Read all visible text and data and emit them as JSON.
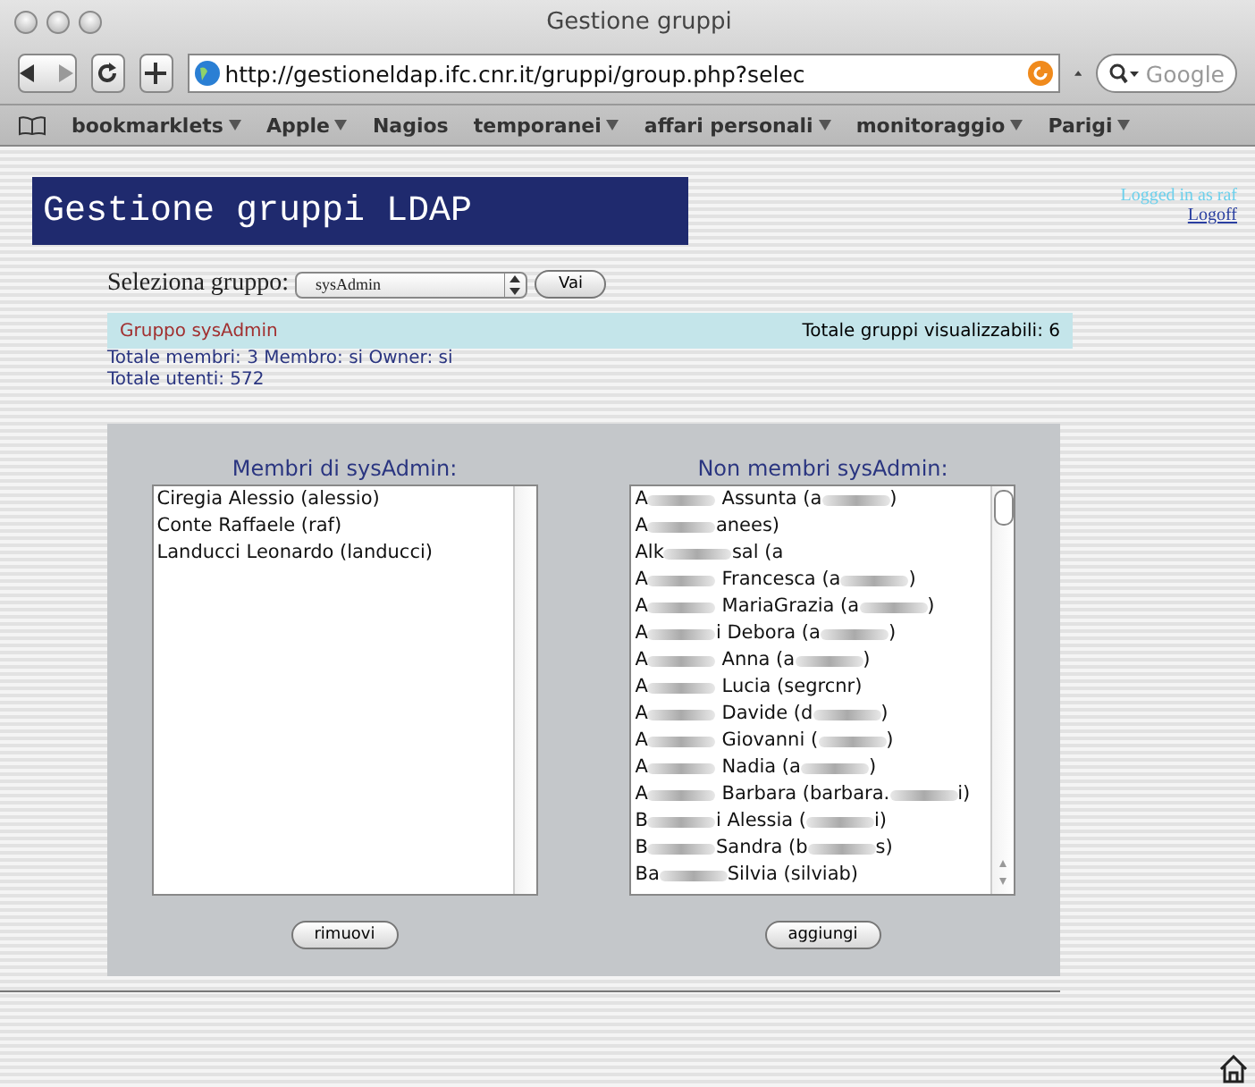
{
  "window": {
    "title": "Gestione gruppi"
  },
  "toolbar": {
    "url": "http://gestioneldap.ifc.cnr.it/gruppi/group.php?selec",
    "search_placeholder": "Google"
  },
  "bookmarks": [
    {
      "label": "bookmarklets",
      "menu": true
    },
    {
      "label": "Apple",
      "menu": true
    },
    {
      "label": "Nagios",
      "menu": false
    },
    {
      "label": "temporanei",
      "menu": true
    },
    {
      "label": "affari personali",
      "menu": true
    },
    {
      "label": "monitoraggio",
      "menu": true
    },
    {
      "label": "Parigi",
      "menu": true
    }
  ],
  "page": {
    "banner": "Gestione gruppi LDAP",
    "logged_in": "Logged in as raf",
    "logoff": "Logoff",
    "select_label": "Seleziona gruppo:",
    "select_value": "sysAdmin",
    "go_button": "Vai",
    "group_title": "Gruppo sysAdmin",
    "total_groups": "Totale gruppi visualizzabili: 6",
    "members_info": "Totale membri: 3 Membro: si Owner: si",
    "users_info": "Totale utenti: 572"
  },
  "members": {
    "title": "Membri di sysAdmin:",
    "button": "rimuovi",
    "items": [
      [
        {
          "kind": "text",
          "text": "Ciregia Alessio (alessio)"
        }
      ],
      [
        {
          "kind": "text",
          "text": "Conte Raffaele (raf)"
        }
      ],
      [
        {
          "kind": "text",
          "text": "Landucci Leonardo (landucci)"
        }
      ]
    ]
  },
  "non_members": {
    "title": "Non membri sysAdmin:",
    "button": "aggiungi",
    "items": [
      [
        {
          "kind": "text",
          "text": "A"
        },
        {
          "kind": "blur"
        },
        {
          "kind": "text",
          "text": " Assunta (a"
        },
        {
          "kind": "blur"
        },
        {
          "kind": "text",
          "text": ")"
        }
      ],
      [
        {
          "kind": "text",
          "text": "A"
        },
        {
          "kind": "blur"
        },
        {
          "kind": "text",
          "text": "anees)"
        }
      ],
      [
        {
          "kind": "text",
          "text": "Alk"
        },
        {
          "kind": "blur"
        },
        {
          "kind": "text",
          "text": "sal (a"
        }
      ],
      [
        {
          "kind": "text",
          "text": "A"
        },
        {
          "kind": "blur"
        },
        {
          "kind": "text",
          "text": " Francesca (a"
        },
        {
          "kind": "blur"
        },
        {
          "kind": "text",
          "text": ")"
        }
      ],
      [
        {
          "kind": "text",
          "text": "A"
        },
        {
          "kind": "blur"
        },
        {
          "kind": "text",
          "text": " MariaGrazia (a"
        },
        {
          "kind": "blur"
        },
        {
          "kind": "text",
          "text": ")"
        }
      ],
      [
        {
          "kind": "text",
          "text": "A"
        },
        {
          "kind": "blur"
        },
        {
          "kind": "text",
          "text": "i Debora (a"
        },
        {
          "kind": "blur"
        },
        {
          "kind": "text",
          "text": ")"
        }
      ],
      [
        {
          "kind": "text",
          "text": "A"
        },
        {
          "kind": "blur"
        },
        {
          "kind": "text",
          "text": " Anna (a"
        },
        {
          "kind": "blur"
        },
        {
          "kind": "text",
          "text": ")"
        }
      ],
      [
        {
          "kind": "text",
          "text": "A"
        },
        {
          "kind": "blur"
        },
        {
          "kind": "text",
          "text": " Lucia (segrcnr)"
        }
      ],
      [
        {
          "kind": "text",
          "text": "A"
        },
        {
          "kind": "blur"
        },
        {
          "kind": "text",
          "text": " Davide (d"
        },
        {
          "kind": "blur"
        },
        {
          "kind": "text",
          "text": ")"
        }
      ],
      [
        {
          "kind": "text",
          "text": "A"
        },
        {
          "kind": "blur"
        },
        {
          "kind": "text",
          "text": " Giovanni ("
        },
        {
          "kind": "blur"
        },
        {
          "kind": "text",
          "text": ")"
        }
      ],
      [
        {
          "kind": "text",
          "text": "A"
        },
        {
          "kind": "blur"
        },
        {
          "kind": "text",
          "text": " Nadia (a"
        },
        {
          "kind": "blur"
        },
        {
          "kind": "text",
          "text": ")"
        }
      ],
      [
        {
          "kind": "text",
          "text": "A"
        },
        {
          "kind": "blur"
        },
        {
          "kind": "text",
          "text": " Barbara (barbara."
        },
        {
          "kind": "blur"
        },
        {
          "kind": "text",
          "text": "i)"
        }
      ],
      [
        {
          "kind": "text",
          "text": "B"
        },
        {
          "kind": "blur"
        },
        {
          "kind": "text",
          "text": "i Alessia ("
        },
        {
          "kind": "blur"
        },
        {
          "kind": "text",
          "text": "i)"
        }
      ],
      [
        {
          "kind": "text",
          "text": "B"
        },
        {
          "kind": "blur"
        },
        {
          "kind": "text",
          "text": "Sandra (b"
        },
        {
          "kind": "blur"
        },
        {
          "kind": "text",
          "text": "s)"
        }
      ],
      [
        {
          "kind": "text",
          "text": "Ba"
        },
        {
          "kind": "blur"
        },
        {
          "kind": "text",
          "text": "Silvia (silviab)"
        }
      ]
    ]
  }
}
